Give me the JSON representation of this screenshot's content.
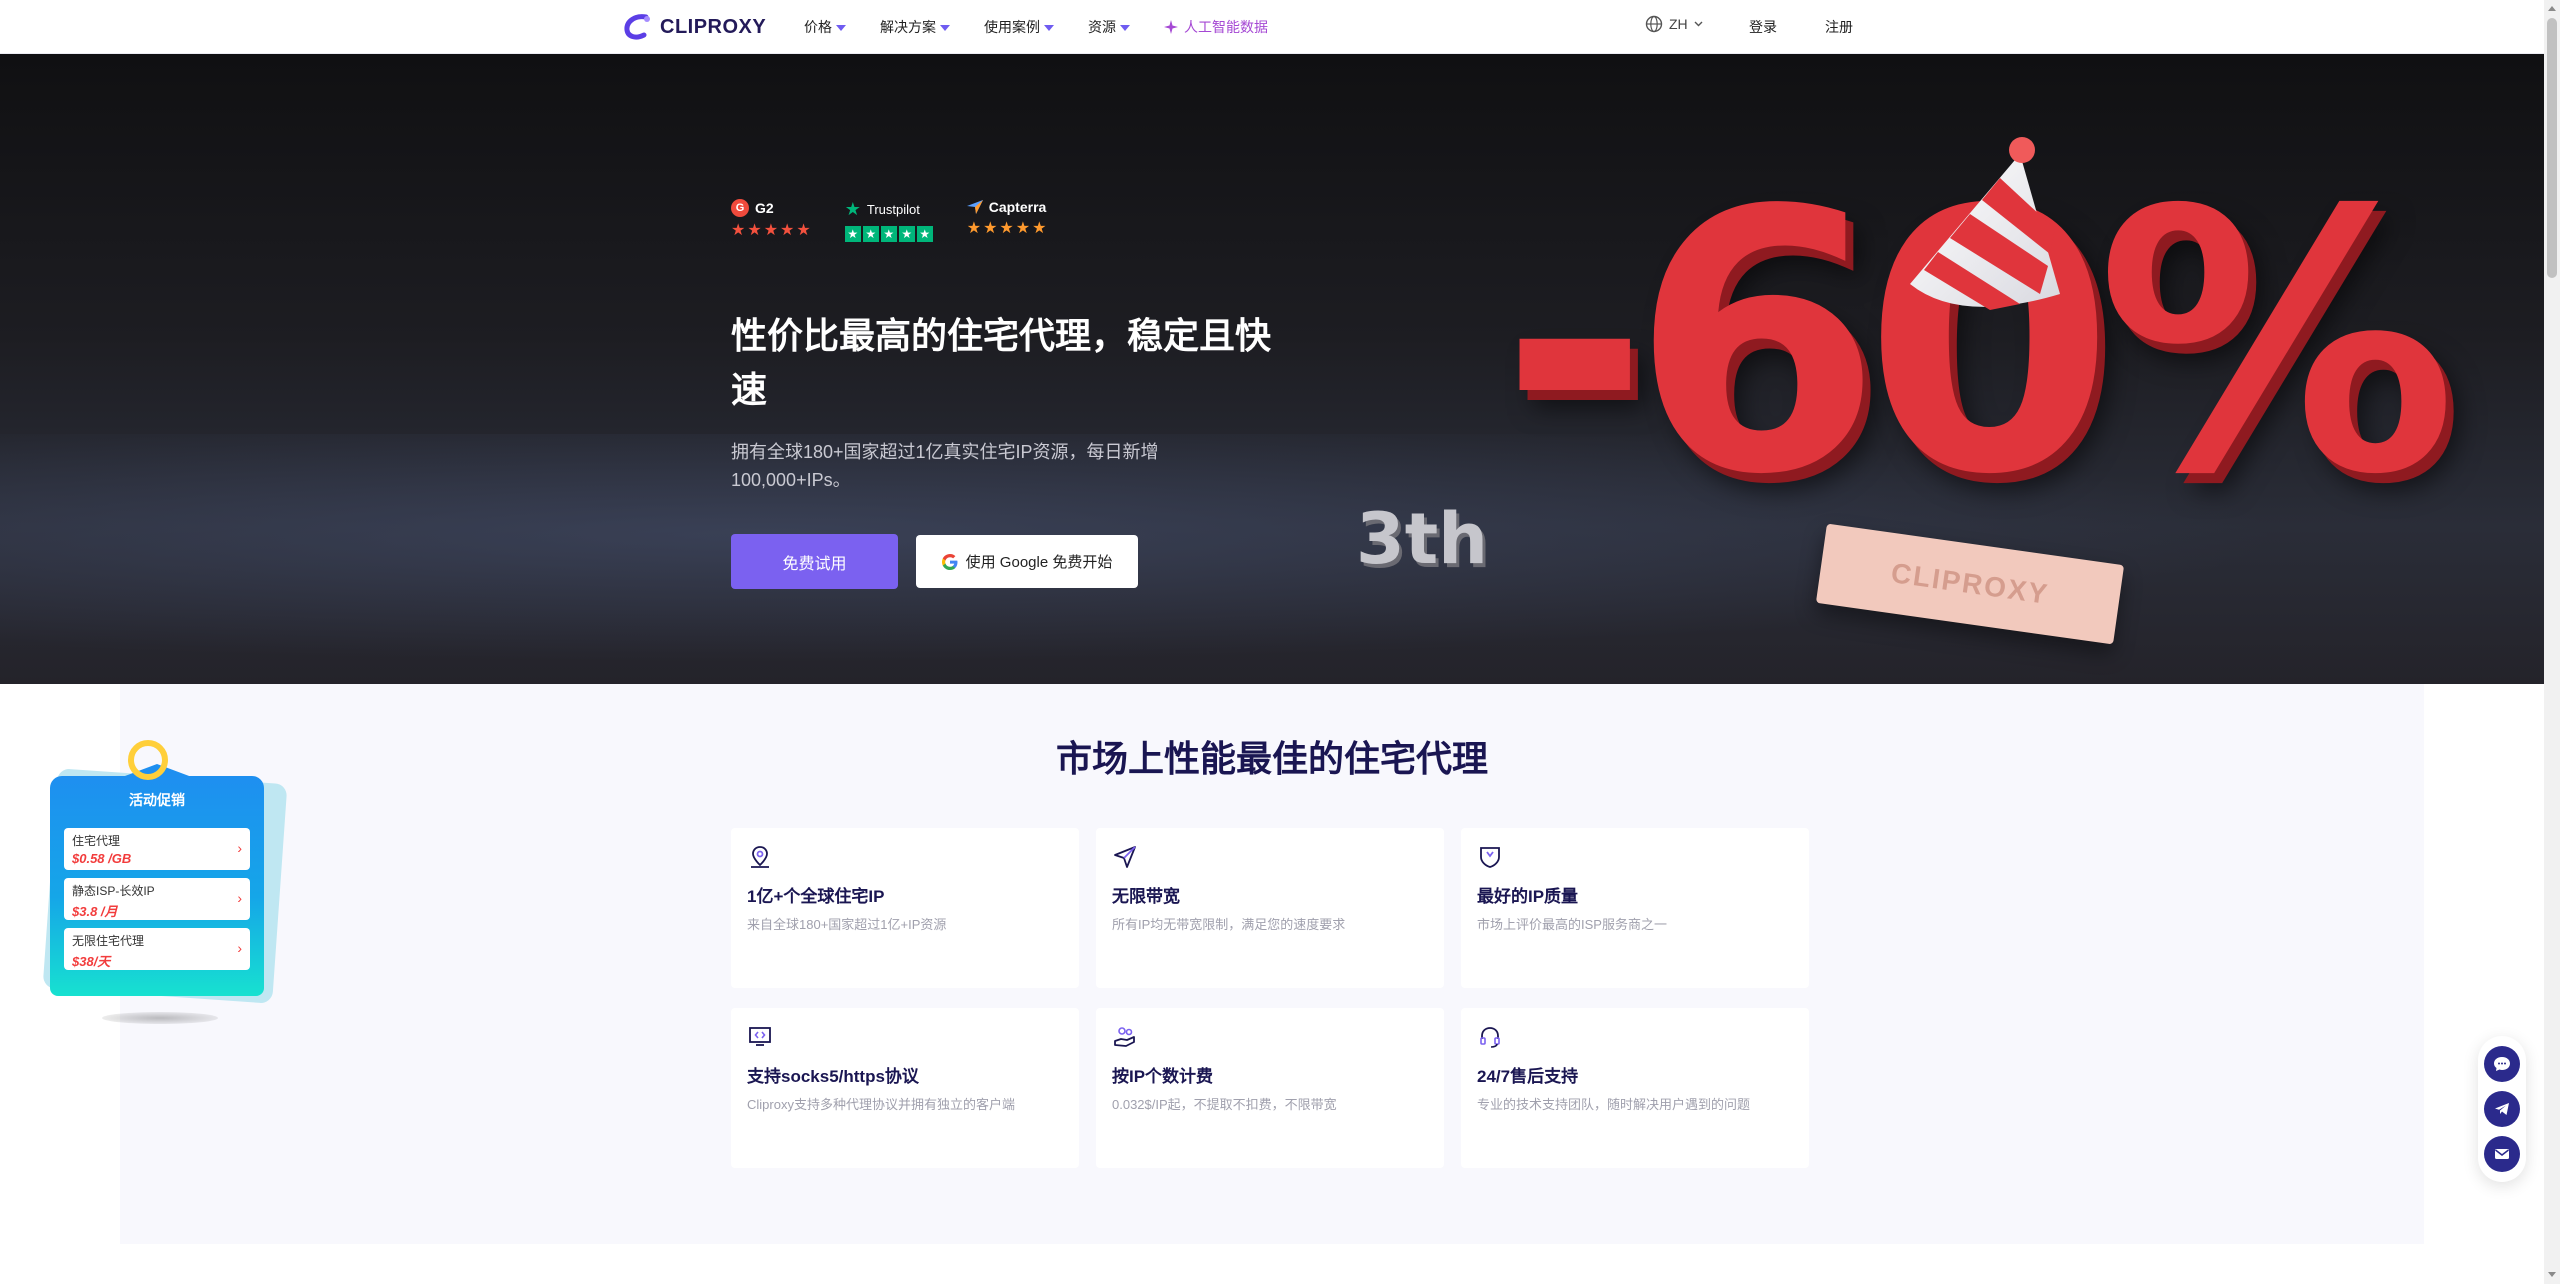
{
  "header": {
    "logo_text": "CLIPROXY",
    "nav": [
      {
        "label": "价格",
        "has_caret": true
      },
      {
        "label": "解决方案",
        "has_caret": true
      },
      {
        "label": "使用案例",
        "has_caret": true
      },
      {
        "label": "资源",
        "has_caret": true
      }
    ],
    "ai_label": "人工智能数据",
    "lang": "ZH",
    "login": "登录",
    "signup": "注册"
  },
  "hero": {
    "ratings": [
      {
        "name": "G2",
        "stars": "★★★★★"
      },
      {
        "name": "Trustpilot",
        "stars": "★★★★★"
      },
      {
        "name": "Capterra",
        "stars": "★★★★★"
      }
    ],
    "title": "性价比最高的住宅代理，稳定且快速",
    "subtitle": "拥有全球180+国家超过1亿真实住宅IP资源，每日新增100,000+IPs。",
    "cta_trial": "免费试用",
    "cta_google": "使用 Google 免费开始",
    "art_discount": "-60%",
    "art_edition": "3th",
    "art_ticket": "CLIPROXY"
  },
  "features": {
    "title": "市场上性能最佳的住宅代理",
    "cards": [
      {
        "title": "1亿+个全球住宅IP",
        "desc": "来自全球180+国家超过1亿+IP资源",
        "icon": "location-pin-icon"
      },
      {
        "title": "无限带宽",
        "desc": "所有IP均无带宽限制，满足您的速度要求",
        "icon": "paper-plane-icon"
      },
      {
        "title": "最好的IP质量",
        "desc": "市场上评价最高的ISP服务商之一",
        "icon": "shield-icon"
      },
      {
        "title": "支持socks5/https协议",
        "desc": "Cliproxy支持多种代理协议并拥有独立的客户端",
        "icon": "monitor-code-icon"
      },
      {
        "title": "按IP个数计费",
        "desc": "0.032$/IP起，不提取不扣费，不限带宽",
        "icon": "hand-coin-icon"
      },
      {
        "title": "24/7售后支持",
        "desc": "专业的技术支持团队，随时解决用户遇到的问题",
        "icon": "headset-icon"
      }
    ]
  },
  "promo": {
    "title": "活动促销",
    "items": [
      {
        "name": "住宅代理",
        "price": "$0.58 /GB"
      },
      {
        "name": "静态ISP-长效IP",
        "price": "$3.8 /月"
      },
      {
        "name": "无限住宅代理",
        "price": "$38/天"
      }
    ]
  },
  "colors": {
    "accent": "#7b61f0",
    "dark_navy": "#1a1652",
    "ai_pink": "#a548d4"
  }
}
